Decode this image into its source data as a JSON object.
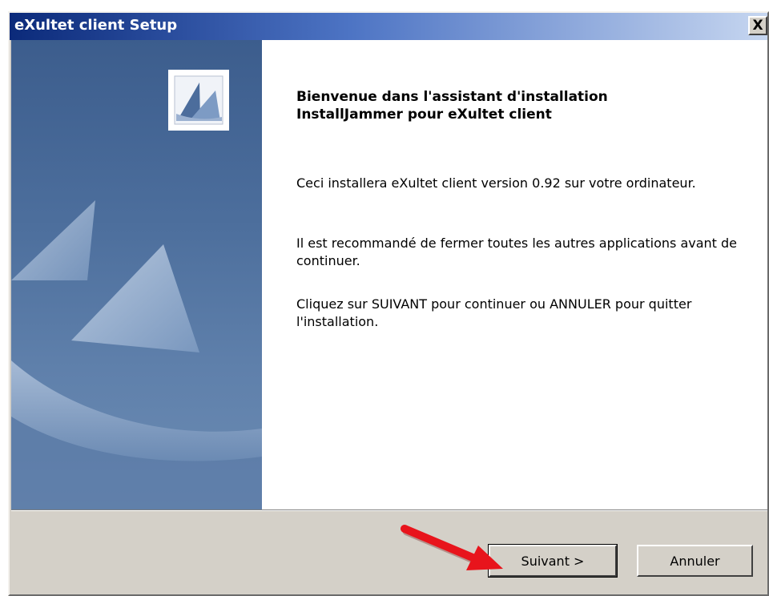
{
  "window": {
    "title": "eXultet client Setup",
    "close_symbol": "X"
  },
  "content": {
    "heading_line1": "Bienvenue dans l'assistant d'installation",
    "heading_line2": "InstallJammer pour eXultet client",
    "paragraph1": "Ceci installera eXultet client version 0.92 sur votre ordinateur.",
    "paragraph2": "Il est recommandé de fermer toutes les autres applications avant  de continuer.",
    "paragraph3": "Cliquez sur SUIVANT pour continuer ou ANNULER pour quitter l'installation."
  },
  "buttons": {
    "next_label": "Suivant >",
    "cancel_label": "Annuler"
  },
  "icons": {
    "logo": "installjammer-logo-icon",
    "close": "close-icon",
    "annotation": "red-arrow-annotation-icon"
  },
  "colors": {
    "title_bar_start": "#0b2a7a",
    "title_bar_end": "#c6d6f0",
    "side_panel": "#4d6f9d",
    "dialog_face": "#d4d0c8",
    "arrow": "#e8141c"
  }
}
